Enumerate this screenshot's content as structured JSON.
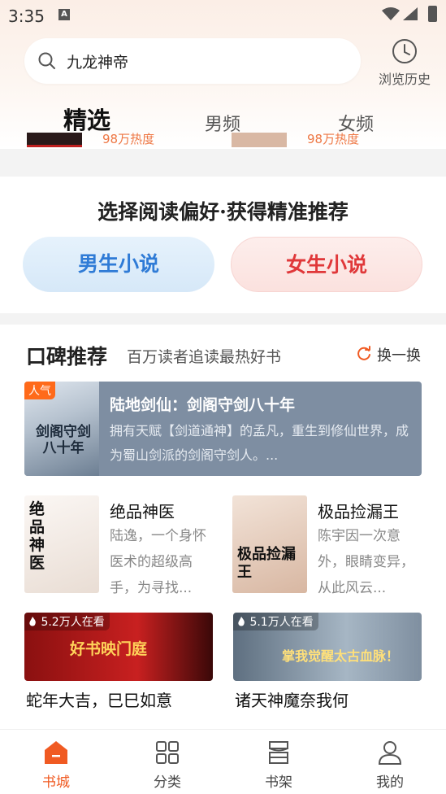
{
  "status_bar": {
    "time": "3:35",
    "notification_icon": "A"
  },
  "search": {
    "placeholder": "九龙神帝"
  },
  "history": {
    "label": "浏览历史"
  },
  "tabs": [
    {
      "label": "精选",
      "active": true
    },
    {
      "label": "男频",
      "active": false
    },
    {
      "label": "女频",
      "active": false
    }
  ],
  "peek": {
    "heat_1": "98万热度",
    "heat_2": "98万热度"
  },
  "preference": {
    "title": "选择阅读偏好·获得精准推荐",
    "male_button": "男生小说",
    "female_button": "女生小说"
  },
  "recommend": {
    "title": "口碑推荐",
    "subtitle": "百万读者追读最热好书",
    "refresh_label": "换一换",
    "hero": {
      "badge": "人气",
      "cover_text": "剑阁守剑八十年",
      "title": "陆地剑仙：剑阁守剑八十年",
      "desc": "拥有天赋【剑道通神】的孟凡，重生到修仙世界，成为蜀山剑派的剑阁守剑人。..."
    },
    "books": [
      {
        "title": "绝品神医",
        "cover_text": "绝品神医",
        "desc": "陆逸，一个身怀医术的超级高手，为寻找..."
      },
      {
        "title": "极品捡漏王",
        "cover_text": "极品捡漏王",
        "desc": "陈宇因一次意外，眼睛变异，从此风云..."
      }
    ],
    "banners": [
      {
        "hot": "5.2万人在看",
        "art_text": "好书映门庭",
        "name": "蛇年大吉，巳巳如意"
      },
      {
        "hot": "5.1万人在看",
        "art_text": "掌我觉醒太古血脉！",
        "name": "诸天神魔奈我何"
      }
    ]
  },
  "bottom_nav": [
    {
      "label": "书城",
      "icon": "home-icon",
      "active": true
    },
    {
      "label": "分类",
      "icon": "grid-icon",
      "active": false
    },
    {
      "label": "书架",
      "icon": "bookshelf-icon",
      "active": false
    },
    {
      "label": "我的",
      "icon": "profile-icon",
      "active": false
    }
  ],
  "colors": {
    "accent": "#f05a22",
    "male_blue": "#2f7bd6",
    "female_red": "#e0383a"
  }
}
